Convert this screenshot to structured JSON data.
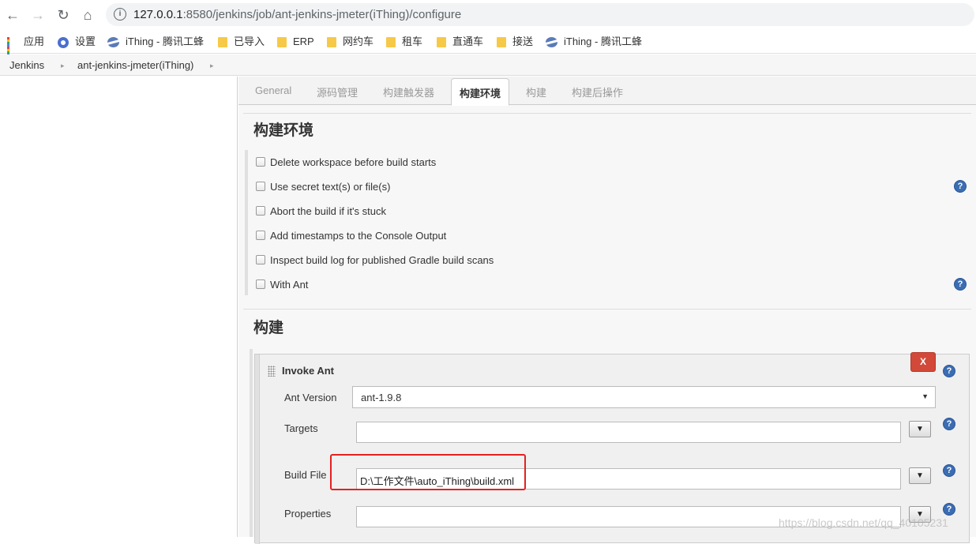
{
  "browser": {
    "url_host": "127.0.0.1",
    "url_rest": ":8580/jenkins/job/ant-jenkins-jmeter(iThing)/configure",
    "bookmarks": [
      {
        "label": "应用",
        "icon": "apps-icon"
      },
      {
        "label": "设置",
        "icon": "gear-icon"
      },
      {
        "label": "iThing - 腾讯工蜂",
        "icon": "site-icon"
      },
      {
        "label": "已导入",
        "icon": "folder-icon"
      },
      {
        "label": "ERP",
        "icon": "folder-icon"
      },
      {
        "label": "网约车",
        "icon": "folder-icon"
      },
      {
        "label": "租车",
        "icon": "folder-icon"
      },
      {
        "label": "直通车",
        "icon": "folder-icon"
      },
      {
        "label": "接送",
        "icon": "folder-icon"
      },
      {
        "label": "iThing - 腾讯工蜂",
        "icon": "site-icon"
      }
    ]
  },
  "breadcrumb": {
    "items": [
      "Jenkins",
      "ant-jenkins-jmeter(iThing)"
    ]
  },
  "tabs": [
    "General",
    "源码管理",
    "构建触发器",
    "构建环境",
    "构建",
    "构建后操作"
  ],
  "build_env": {
    "title": "构建环境",
    "options": [
      "Delete workspace before build starts",
      "Use secret text(s) or file(s)",
      "Abort the build if it's stuck",
      "Add timestamps to the Console Output",
      "Inspect build log for published Gradle build scans",
      "With Ant"
    ]
  },
  "build": {
    "title": "构建",
    "step": {
      "title": "Invoke Ant",
      "delete_label": "X",
      "ant_version_label": "Ant Version",
      "ant_version_value": "ant-1.9.8",
      "targets_label": "Targets",
      "targets_value": "",
      "build_file_label": "Build File",
      "build_file_value": "D:\\工作文件\\auto_iThing\\build.xml",
      "properties_label": "Properties",
      "properties_value": ""
    }
  },
  "help_glyph": "?",
  "expand_glyph": "▼",
  "select_arrow_glyph": "▼",
  "watermark": "https://blog.csdn.net/qq_40105231",
  "colors": {
    "help_blue": "#3b6db3",
    "delete_red": "#d24939",
    "highlight_red": "#e52020"
  }
}
